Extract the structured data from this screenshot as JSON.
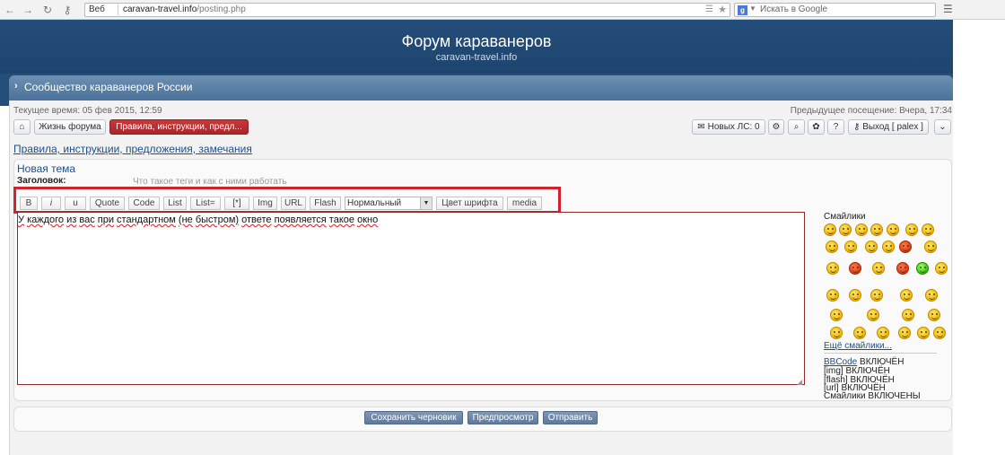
{
  "browser": {
    "web_label": "Веб",
    "url_host": "caravan-travel.info",
    "url_path": "/posting.php",
    "search_placeholder": "Искать в Google"
  },
  "header": {
    "title": "Форум караванеров",
    "subtitle": "caravan-travel.info"
  },
  "navbar": {
    "community": "Сообщество караванеров России"
  },
  "info": {
    "current_time": "Текущее время: 05 фев 2015, 12:59",
    "last_visit": "Предыдущее посещение: Вчера, 17:34"
  },
  "toolbar": {
    "forum_life": "Жизнь форума",
    "rules_tab": "Правила, инструкции, предл...",
    "new_pm": "Новых ЛС: 0",
    "logout": "Выход [ palex ]"
  },
  "breadcrumb": "Правила, инструкции, предложения, замечания",
  "form": {
    "new_topic": "Новая тема",
    "subject_label": "Заголовок:",
    "subject_value": "Что такое теги и как с ними работать",
    "message_words": [
      "У",
      "каждого",
      "из",
      "вас",
      "при",
      "стандартном",
      "(не",
      "быстром)",
      "ответе",
      "появляется",
      "такое",
      "окно"
    ]
  },
  "bbcode": {
    "buttons": [
      "B",
      "i",
      "u",
      "Quote",
      "Code",
      "List",
      "List=",
      "[*]",
      "Img",
      "URL",
      "Flash"
    ],
    "font_size": "Нормальный",
    "font_color": "Цвет шрифта",
    "media": "media"
  },
  "smilies": {
    "title": "Смайлики",
    "more": "Ещё смайлики..."
  },
  "status": {
    "bbcode_link": "BBCode",
    "bbcode_state": "ВКЛЮЧЁН",
    "img": "[img] ВКЛЮЧЁН",
    "flash": "[flash] ВКЛЮЧЁН",
    "url": "[url] ВКЛЮЧЁН",
    "smilies": "Смайлики ВКЛЮЧЕНЫ"
  },
  "actions": {
    "save_draft": "Сохранить черновик",
    "preview": "Предпросмотр",
    "submit": "Отправить"
  }
}
